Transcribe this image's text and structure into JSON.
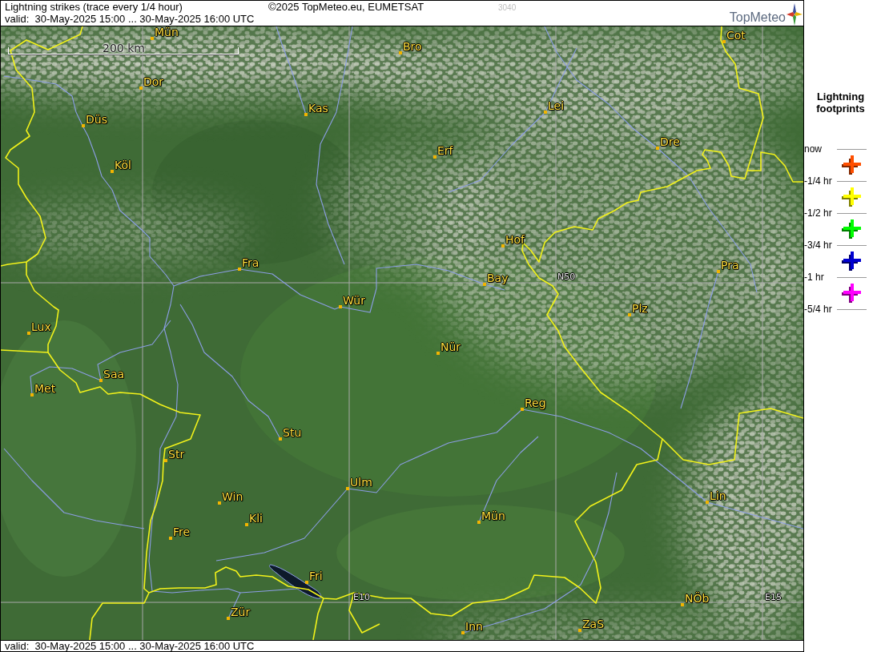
{
  "header": {
    "title": "Lightning strikes (trace every 1/4 hour)",
    "copyright": "©2025 TopMeteo.eu, EUMETSAT",
    "code": "3040",
    "validity": "valid:  30-May-2025 15:00 ... 30-May-2025 16:00 UTC",
    "logo": "TopMeteo"
  },
  "map": {
    "scale_bar": "200 km",
    "grid_labels": [
      "N50",
      "E10",
      "E15"
    ],
    "cities": [
      {
        "name": "Mün"
      },
      {
        "name": "Cot"
      },
      {
        "name": "Bro"
      },
      {
        "name": "Dor"
      },
      {
        "name": "Lei"
      },
      {
        "name": "Kas"
      },
      {
        "name": "Düs"
      },
      {
        "name": "Dre"
      },
      {
        "name": "Erf"
      },
      {
        "name": "Köl"
      },
      {
        "name": "Hof"
      },
      {
        "name": "Fra"
      },
      {
        "name": "Pra"
      },
      {
        "name": "Bay"
      },
      {
        "name": "Wür"
      },
      {
        "name": "Plz"
      },
      {
        "name": "Lux"
      },
      {
        "name": "Nür"
      },
      {
        "name": "Saa"
      },
      {
        "name": "Met"
      },
      {
        "name": "Reg"
      },
      {
        "name": "Stu"
      },
      {
        "name": "Str"
      },
      {
        "name": "Ulm"
      },
      {
        "name": "Lin"
      },
      {
        "name": "Win"
      },
      {
        "name": "Mün"
      },
      {
        "name": "Kli"
      },
      {
        "name": "Fre"
      },
      {
        "name": "Fri"
      },
      {
        "name": "NÖb"
      },
      {
        "name": "Zür"
      },
      {
        "name": "ZaS"
      },
      {
        "name": "Inn"
      }
    ]
  },
  "footer": {
    "validity": "valid:  30-May-2025 15:00 ... 30-May-2025 16:00 UTC"
  },
  "legend": {
    "title": "Lightning footprints",
    "time_marks": [
      "now",
      "-1/4 hr",
      "-1/2 hr",
      "-3/4 hr",
      "-1 hr",
      "-5/4 hr"
    ],
    "footprints": [
      {
        "color": "#ff4f00"
      },
      {
        "color": "#ffff00"
      },
      {
        "color": "#00ff00"
      },
      {
        "color": "#0000d0"
      },
      {
        "color": "#ff00ff"
      }
    ]
  }
}
